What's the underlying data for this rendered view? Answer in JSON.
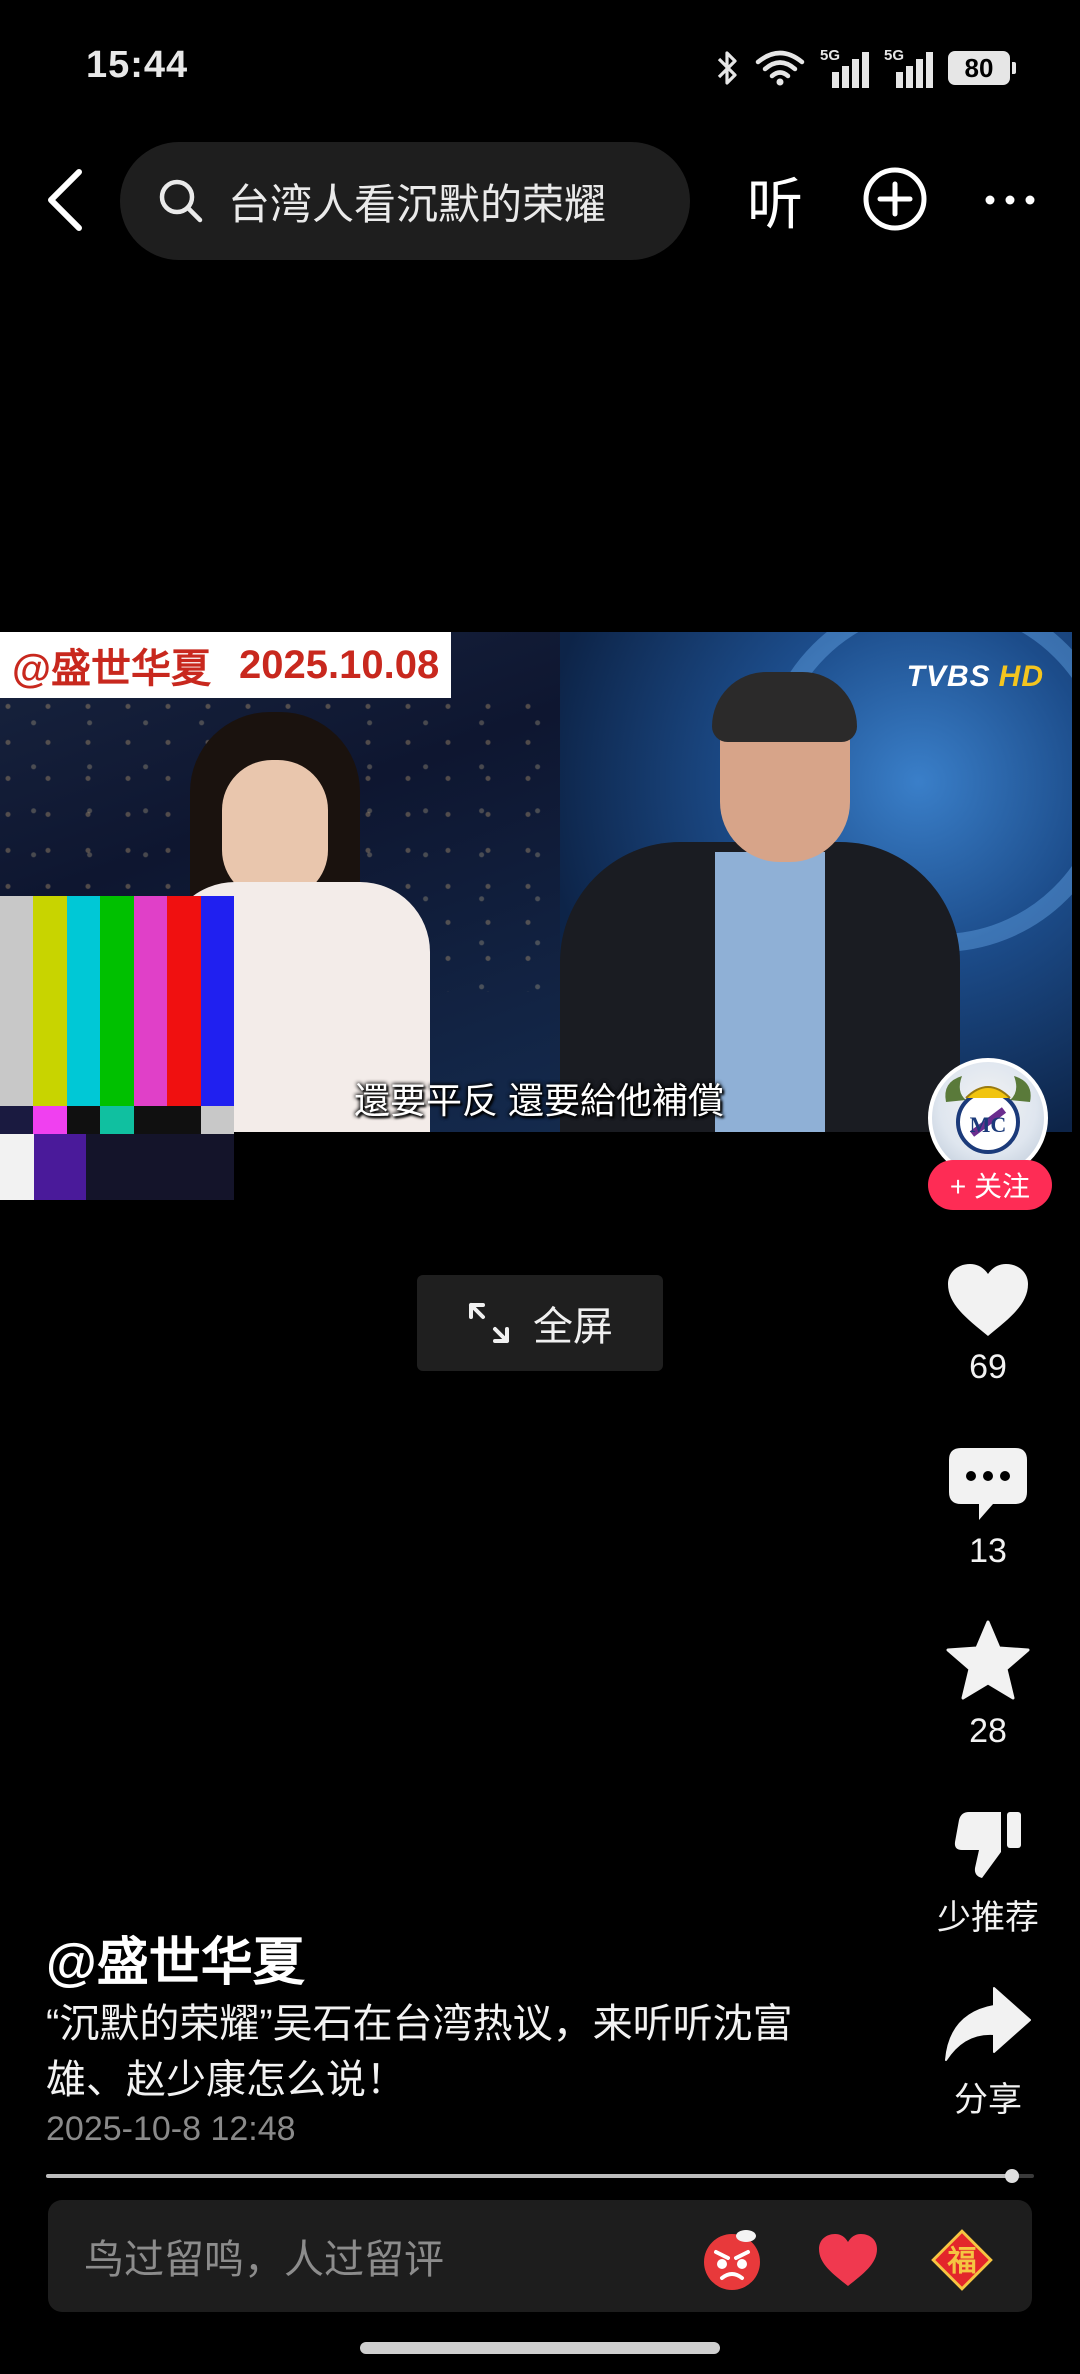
{
  "status_bar": {
    "time": "15:44",
    "battery": "80",
    "network_1": "5G",
    "network_2": "5G"
  },
  "header": {
    "search_query": "台湾人看沉默的荣耀",
    "listen_label": "听"
  },
  "video": {
    "watermark_account": "@盛世华夏",
    "watermark_date": "2025.10.08",
    "channel_logo": "TVBS",
    "channel_logo_hd": "HD",
    "subtitle": "還要平反 還要給他補償",
    "fullscreen_label": "全屏",
    "progress_fraction": 0.978
  },
  "actions": {
    "follow_label": "+ 关注",
    "likes": "69",
    "comments": "13",
    "favorites": "28",
    "not_interested_label": "少推荐",
    "share_label": "分享"
  },
  "post": {
    "author": "@盛世华夏",
    "description": "“沉默的荣耀”吴石在台湾热议，来听听沈富雄、赵少康怎么说！",
    "timestamp": "2025-10-8 12:48"
  },
  "comment_bar": {
    "placeholder": "鸟过留鸣，人过留评",
    "fu_label": "福"
  },
  "colors": {
    "accent": "#fe2c55",
    "watermark_text": "#c8281e",
    "background": "#000000"
  },
  "icons": [
    "back-arrow-icon",
    "search-icon",
    "add-circle-icon",
    "more-icon",
    "heart-icon",
    "comment-icon",
    "star-icon",
    "thumb-down-icon",
    "share-icon",
    "expand-icon",
    "angry-emoji-icon",
    "heart-emoji-icon",
    "fu-emoji-icon",
    "bluetooth-icon",
    "wifi-icon",
    "signal-icon"
  ]
}
